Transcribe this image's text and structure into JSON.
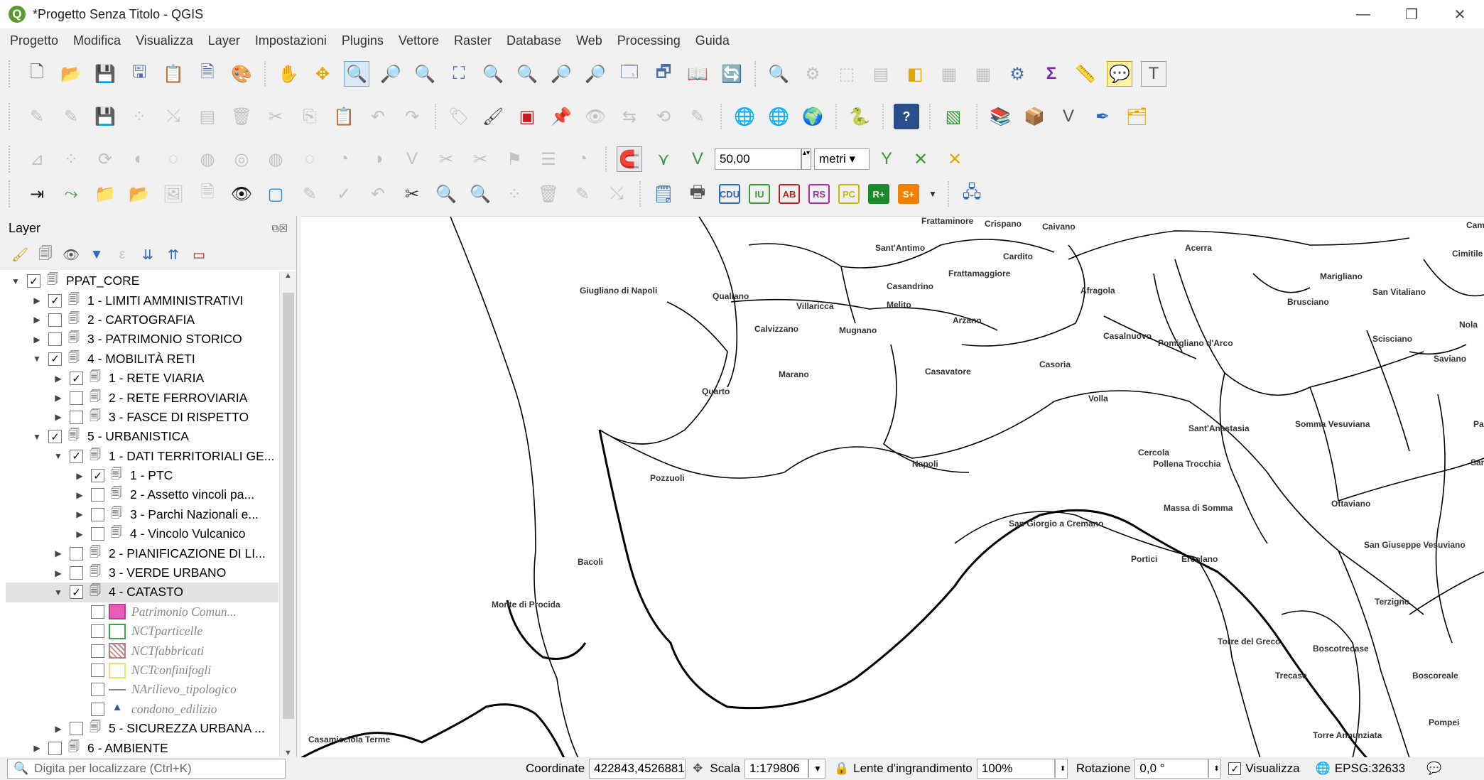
{
  "window": {
    "title": "*Progetto Senza Titolo - QGIS",
    "controls": [
      "—",
      "❐",
      "✕"
    ]
  },
  "menu": [
    "Progetto",
    "Modifica",
    "Visualizza",
    "Layer",
    "Impostazioni",
    "Plugins",
    "Vettore",
    "Raster",
    "Database",
    "Web",
    "Processing",
    "Guida"
  ],
  "digitizing": {
    "tolerance": "50,00",
    "unit": "metri"
  },
  "plugin_buttons": [
    "CDU",
    "IU",
    "AB",
    "RS",
    "PC",
    "R+",
    "S+"
  ],
  "layer_panel": {
    "title": "Layer",
    "items": [
      {
        "label": "PPAT_CORE",
        "checked": true,
        "level": 0,
        "expanded": true
      },
      {
        "label": "1 - LIMITI AMMINISTRATIVI",
        "checked": true,
        "level": 1
      },
      {
        "label": "2 - CARTOGRAFIA",
        "checked": false,
        "level": 1
      },
      {
        "label": "3 - PATRIMONIO STORICO",
        "checked": false,
        "level": 1
      },
      {
        "label": "4 - MOBILITÀ RETI",
        "checked": true,
        "level": 1,
        "expanded": true
      },
      {
        "label": "1 - RETE VIARIA",
        "checked": true,
        "level": 2
      },
      {
        "label": "2 - RETE FERROVIARIA",
        "checked": false,
        "level": 2
      },
      {
        "label": "3 - FASCE DI RISPETTO",
        "checked": false,
        "level": 2
      },
      {
        "label": "5 - URBANISTICA",
        "checked": true,
        "level": 1,
        "expanded": true
      },
      {
        "label": "1 - DATI TERRITORIALI GE...",
        "checked": true,
        "level": 2,
        "expanded": true
      },
      {
        "label": "1 - PTC",
        "checked": true,
        "level": 3
      },
      {
        "label": "2 - Assetto vincoli pa...",
        "checked": false,
        "level": 3
      },
      {
        "label": "3 - Parchi Nazionali e...",
        "checked": false,
        "level": 3
      },
      {
        "label": "4 - Vincolo Vulcanico",
        "checked": false,
        "level": 3
      },
      {
        "label": "2 - PIANIFICAZIONE DI LI...",
        "checked": false,
        "level": 2
      },
      {
        "label": "3 - VERDE URBANO",
        "checked": false,
        "level": 2
      },
      {
        "label": "4 - CATASTO",
        "checked": true,
        "level": 2,
        "expanded": true,
        "selected": true
      },
      {
        "label": "Patrimonio Comun...",
        "checked": false,
        "level": 3,
        "symbol": "pink-fill",
        "italic": true
      },
      {
        "label": "NCTparticelle",
        "checked": false,
        "level": 3,
        "symbol": "green-outline",
        "italic": true
      },
      {
        "label": "NCTfabbricati",
        "checked": false,
        "level": 3,
        "symbol": "hatch",
        "italic": true
      },
      {
        "label": "NCTconfinifogli",
        "checked": false,
        "level": 3,
        "symbol": "yellow-outline",
        "italic": true
      },
      {
        "label": "NArilievo_tipologico",
        "checked": false,
        "level": 3,
        "symbol": "line",
        "italic": true
      },
      {
        "label": "condono_edilizio",
        "checked": false,
        "level": 3,
        "symbol": "triangle",
        "italic": true
      },
      {
        "label": "5 - SICUREZZA URBANA ...",
        "checked": false,
        "level": 2
      },
      {
        "label": "6 - AMBIENTE",
        "checked": false,
        "level": 1
      }
    ]
  },
  "map_labels": [
    "Frattaminore",
    "Crispano",
    "Caivano",
    "Acerra",
    "Cimitile",
    "Sant'Antimo",
    "Cardito",
    "Giugliano di Napoli",
    "Qualiano",
    "Frattamaggiore",
    "Afragola",
    "Marigliano",
    "San Vitaliano",
    "Casandrino",
    "Brusciano",
    "Villaricca",
    "Melito",
    "Calvizzano",
    "Mugnano",
    "Arzano",
    "Casalnuovo",
    "Nola",
    "Pomigliano d'Arco",
    "Scisciano",
    "Casoria",
    "Saviano",
    "Marano",
    "Casavatore",
    "Quarto",
    "Volla",
    "Sant'Anastasia",
    "Somma Vesuviana",
    "Cercola",
    "Pollena Trocchia",
    "Napoli",
    "Pozzuoli",
    "Massa di Somma",
    "Ottaviano",
    "San Giorgio a Cremano",
    "San Giuseppe Vesuviano",
    "Portici",
    "Ercolano",
    "Bacoli",
    "Monte di Procida",
    "Terzigno",
    "Torre del Greco",
    "Boscotrecase",
    "Trecase",
    "Boscoreale",
    "Pompei",
    "Casamicciola Terme",
    "Torre Annunziata",
    "Cam",
    "Pa",
    "San"
  ],
  "status": {
    "locator_placeholder": "Digita per localizzare (Ctrl+K)",
    "coord_label": "Coordinate",
    "coord_value": "422843,4526881",
    "scale_label": "Scala",
    "scale_value": "1:179806",
    "magnifier_label": "Lente d'ingrandimento",
    "magnifier_value": "100%",
    "rotation_label": "Rotazione",
    "rotation_value": "0,0 °",
    "render_label": "Visualizza",
    "crs": "EPSG:32633"
  }
}
